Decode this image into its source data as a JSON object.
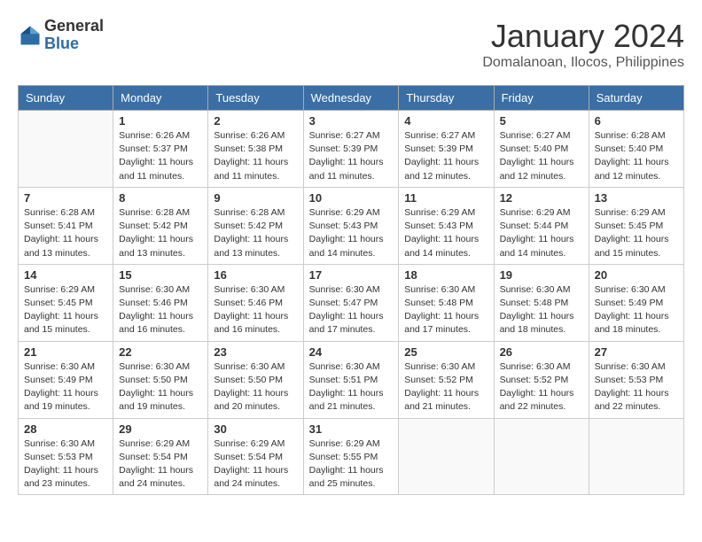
{
  "header": {
    "logo_general": "General",
    "logo_blue": "Blue",
    "month_title": "January 2024",
    "subtitle": "Domalanoan, Ilocos, Philippines"
  },
  "weekdays": [
    "Sunday",
    "Monday",
    "Tuesday",
    "Wednesday",
    "Thursday",
    "Friday",
    "Saturday"
  ],
  "weeks": [
    [
      {
        "day": "",
        "info": ""
      },
      {
        "day": "1",
        "info": "Sunrise: 6:26 AM\nSunset: 5:37 PM\nDaylight: 11 hours and 11 minutes."
      },
      {
        "day": "2",
        "info": "Sunrise: 6:26 AM\nSunset: 5:38 PM\nDaylight: 11 hours and 11 minutes."
      },
      {
        "day": "3",
        "info": "Sunrise: 6:27 AM\nSunset: 5:39 PM\nDaylight: 11 hours and 11 minutes."
      },
      {
        "day": "4",
        "info": "Sunrise: 6:27 AM\nSunset: 5:39 PM\nDaylight: 11 hours and 12 minutes."
      },
      {
        "day": "5",
        "info": "Sunrise: 6:27 AM\nSunset: 5:40 PM\nDaylight: 11 hours and 12 minutes."
      },
      {
        "day": "6",
        "info": "Sunrise: 6:28 AM\nSunset: 5:40 PM\nDaylight: 11 hours and 12 minutes."
      }
    ],
    [
      {
        "day": "7",
        "info": "Sunrise: 6:28 AM\nSunset: 5:41 PM\nDaylight: 11 hours and 13 minutes."
      },
      {
        "day": "8",
        "info": "Sunrise: 6:28 AM\nSunset: 5:42 PM\nDaylight: 11 hours and 13 minutes."
      },
      {
        "day": "9",
        "info": "Sunrise: 6:28 AM\nSunset: 5:42 PM\nDaylight: 11 hours and 13 minutes."
      },
      {
        "day": "10",
        "info": "Sunrise: 6:29 AM\nSunset: 5:43 PM\nDaylight: 11 hours and 14 minutes."
      },
      {
        "day": "11",
        "info": "Sunrise: 6:29 AM\nSunset: 5:43 PM\nDaylight: 11 hours and 14 minutes."
      },
      {
        "day": "12",
        "info": "Sunrise: 6:29 AM\nSunset: 5:44 PM\nDaylight: 11 hours and 14 minutes."
      },
      {
        "day": "13",
        "info": "Sunrise: 6:29 AM\nSunset: 5:45 PM\nDaylight: 11 hours and 15 minutes."
      }
    ],
    [
      {
        "day": "14",
        "info": "Sunrise: 6:29 AM\nSunset: 5:45 PM\nDaylight: 11 hours and 15 minutes."
      },
      {
        "day": "15",
        "info": "Sunrise: 6:30 AM\nSunset: 5:46 PM\nDaylight: 11 hours and 16 minutes."
      },
      {
        "day": "16",
        "info": "Sunrise: 6:30 AM\nSunset: 5:46 PM\nDaylight: 11 hours and 16 minutes."
      },
      {
        "day": "17",
        "info": "Sunrise: 6:30 AM\nSunset: 5:47 PM\nDaylight: 11 hours and 17 minutes."
      },
      {
        "day": "18",
        "info": "Sunrise: 6:30 AM\nSunset: 5:48 PM\nDaylight: 11 hours and 17 minutes."
      },
      {
        "day": "19",
        "info": "Sunrise: 6:30 AM\nSunset: 5:48 PM\nDaylight: 11 hours and 18 minutes."
      },
      {
        "day": "20",
        "info": "Sunrise: 6:30 AM\nSunset: 5:49 PM\nDaylight: 11 hours and 18 minutes."
      }
    ],
    [
      {
        "day": "21",
        "info": "Sunrise: 6:30 AM\nSunset: 5:49 PM\nDaylight: 11 hours and 19 minutes."
      },
      {
        "day": "22",
        "info": "Sunrise: 6:30 AM\nSunset: 5:50 PM\nDaylight: 11 hours and 19 minutes."
      },
      {
        "day": "23",
        "info": "Sunrise: 6:30 AM\nSunset: 5:50 PM\nDaylight: 11 hours and 20 minutes."
      },
      {
        "day": "24",
        "info": "Sunrise: 6:30 AM\nSunset: 5:51 PM\nDaylight: 11 hours and 21 minutes."
      },
      {
        "day": "25",
        "info": "Sunrise: 6:30 AM\nSunset: 5:52 PM\nDaylight: 11 hours and 21 minutes."
      },
      {
        "day": "26",
        "info": "Sunrise: 6:30 AM\nSunset: 5:52 PM\nDaylight: 11 hours and 22 minutes."
      },
      {
        "day": "27",
        "info": "Sunrise: 6:30 AM\nSunset: 5:53 PM\nDaylight: 11 hours and 22 minutes."
      }
    ],
    [
      {
        "day": "28",
        "info": "Sunrise: 6:30 AM\nSunset: 5:53 PM\nDaylight: 11 hours and 23 minutes."
      },
      {
        "day": "29",
        "info": "Sunrise: 6:29 AM\nSunset: 5:54 PM\nDaylight: 11 hours and 24 minutes."
      },
      {
        "day": "30",
        "info": "Sunrise: 6:29 AM\nSunset: 5:54 PM\nDaylight: 11 hours and 24 minutes."
      },
      {
        "day": "31",
        "info": "Sunrise: 6:29 AM\nSunset: 5:55 PM\nDaylight: 11 hours and 25 minutes."
      },
      {
        "day": "",
        "info": ""
      },
      {
        "day": "",
        "info": ""
      },
      {
        "day": "",
        "info": ""
      }
    ]
  ]
}
